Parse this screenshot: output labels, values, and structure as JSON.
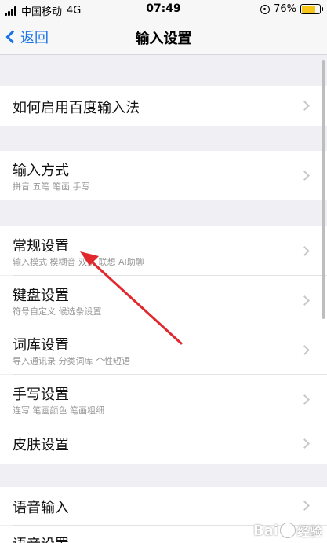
{
  "status_bar": {
    "carrier": "中国移动",
    "network": "4G",
    "time": "07:49",
    "battery_percent": "76%",
    "battery_level": 0.76
  },
  "nav": {
    "back_label": "返回",
    "title": "输入设置"
  },
  "rows": [
    {
      "title": "如何启用百度输入法",
      "subtitle": ""
    },
    {
      "title": "输入方式",
      "subtitle": "拼音 五笔 笔画 手写"
    },
    {
      "title": "常规设置",
      "subtitle": "输入模式 模糊音 双拼 联想 AI助聊"
    },
    {
      "title": "键盘设置",
      "subtitle": "符号自定义 候选条设置"
    },
    {
      "title": "词库设置",
      "subtitle": "导入通讯录 分类词库 个性短语"
    },
    {
      "title": "手写设置",
      "subtitle": "连写 笔画颜色 笔画粗细"
    },
    {
      "title": "皮肤设置",
      "subtitle": ""
    },
    {
      "title": "语音输入",
      "subtitle": ""
    },
    {
      "title": "语音设置",
      "subtitle": ""
    }
  ],
  "watermark": {
    "brand": "Bai",
    "suffix": "经验"
  },
  "colors": {
    "accent": "#1a73e8",
    "arrow": "#e0282e",
    "battery": "#f5c518"
  }
}
